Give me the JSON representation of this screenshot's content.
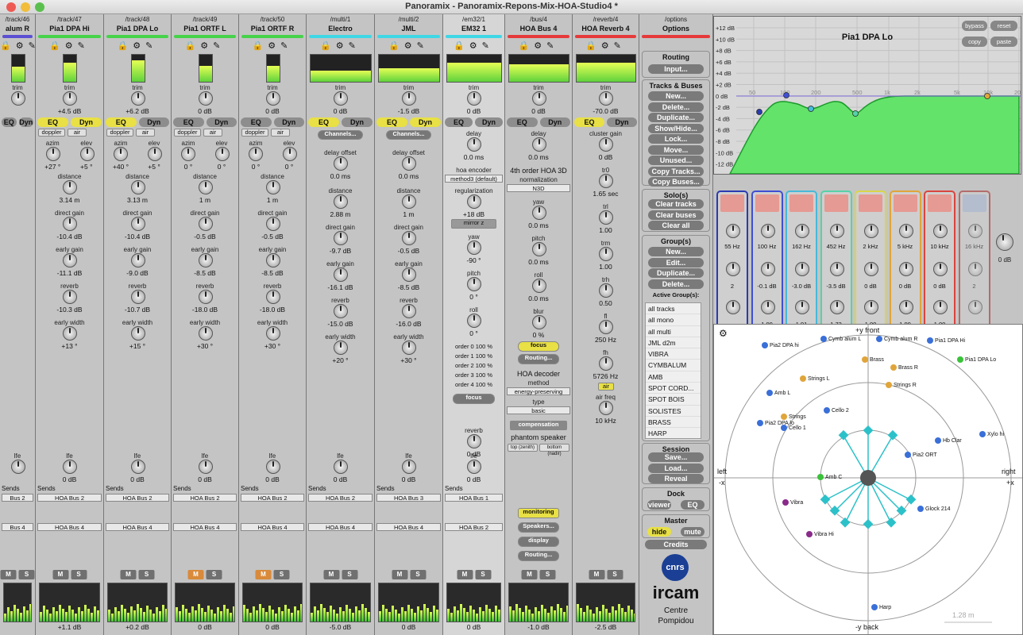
{
  "window": {
    "title": "Panoramix - Panoramix-Repons-Mix-HOA-Studio4 *"
  },
  "strips": [
    {
      "path": "/track/46",
      "name": "alum R",
      "color": "#5b4fd3",
      "trim": "",
      "eq": "EQ",
      "dyn": "Dyn",
      "fader": "",
      "sends1": "Bus 2",
      "sends2": "Bus 4"
    },
    {
      "path": "/track/47",
      "name": "Pia1 DPA Hi",
      "color": "#46d34a",
      "trim": "+4.5 dB",
      "eq": "EQ",
      "dyn": "Dyn",
      "azim": "+27 °",
      "elev": "+5 °",
      "distance": "3.14 m",
      "direct": "-10.4 dB",
      "early": "-11.1 dB",
      "reverb": "-10.3 dB",
      "width": "+13 °",
      "lfe": "0 dB",
      "fader": "+1.1 dB",
      "sends1": "HOA Bus 2",
      "sends2": "HOA Bus 4"
    },
    {
      "path": "/track/48",
      "name": "Pia1 DPA Lo",
      "color": "#46d34a",
      "trim": "+6.2 dB",
      "eq": "EQ",
      "dyn": "Dyn",
      "azim": "+40 °",
      "elev": "+5 °",
      "distance": "3.13 m",
      "direct": "-10.4 dB",
      "early": "-9.0 dB",
      "reverb": "-10.7 dB",
      "width": "+15 °",
      "lfe": "0 dB",
      "fader": "+0.2 dB",
      "sends1": "HOA Bus 2",
      "sends2": "HOA Bus 4"
    },
    {
      "path": "/track/49",
      "name": "Pia1 ORTF L",
      "color": "#46d34a",
      "trim": "0 dB",
      "eq": "EQ",
      "dyn": "Dyn",
      "azim": "0 °",
      "elev": "0 °",
      "distance": "1 m",
      "direct": "-0.5 dB",
      "early": "-8.5 dB",
      "reverb": "-18.0 dB",
      "width": "+30 °",
      "lfe": "0 dB",
      "fader": "0 dB",
      "sends1": "HOA Bus 2",
      "sends2": "HOA Bus 4"
    },
    {
      "path": "/track/50",
      "name": "Pia1 ORTF R",
      "color": "#46d34a",
      "trim": "0 dB",
      "eq": "EQ",
      "dyn": "Dyn",
      "azim": "0 °",
      "elev": "0 °",
      "distance": "1 m",
      "direct": "-0.5 dB",
      "early": "-8.5 dB",
      "reverb": "-18.0 dB",
      "width": "+30 °",
      "lfe": "0 dB",
      "fader": "0 dB",
      "sends1": "HOA Bus 2",
      "sends2": "HOA Bus 4"
    },
    {
      "path": "/multi/1",
      "name": "Electro",
      "color": "#3fd7e6",
      "trim": "0 dB",
      "eq": "EQ",
      "dyn": "Dyn",
      "delay": "0.0 ms",
      "distance": "2.88 m",
      "direct": "-9.7 dB",
      "early": "-16.1 dB",
      "reverb": "-15.0 dB",
      "width": "+20 °",
      "lfe": "0 dB",
      "fader": "-5.0 dB",
      "sends1": "HOA Bus 2",
      "sends2": "HOA Bus 4"
    },
    {
      "path": "/multi/2",
      "name": "JML",
      "color": "#3fd7e6",
      "trim": "-1.5 dB",
      "eq": "EQ",
      "dyn": "Dyn",
      "delay": "0.0 ms",
      "distance": "1 m",
      "direct": "-0.5 dB",
      "early": "-8.5 dB",
      "reverb": "-16.0 dB",
      "width": "+30 °",
      "lfe": "0 dB",
      "fader": "0 dB",
      "sends1": "HOA Bus 3",
      "sends2": "HOA Bus 4"
    },
    {
      "path": "/em32/1",
      "name": "EM32 1",
      "color": "#3fd7e6",
      "trim": "0 dB",
      "eq": "EQ",
      "dyn": "Dyn",
      "delay": "0.0 ms",
      "encoder": "method3 (default)",
      "regularization": "+18 dB",
      "yaw": "-90 °",
      "pitch": "0 °",
      "roll": "0 °",
      "reverb": "0 dB",
      "lfe": "0 dB",
      "fader": "0 dB",
      "sends1": "HOA Bus 1",
      "sends2": "HOA Bus 2"
    },
    {
      "path": "/bus/4",
      "name": "HOA Bus 4",
      "color": "#e63a3a",
      "trim": "0 dB",
      "eq": "EQ",
      "dyn": "Dyn",
      "delay": "0.0 ms",
      "fader": "-1.0 dB"
    },
    {
      "path": "/reverb/4",
      "name": "HOA Reverb 4",
      "color": "#e63a3a",
      "trim": "-70.0 dB",
      "eq": "EQ",
      "dyn": "Dyn",
      "cluster": "0 dB",
      "tr0": "1.65 sec",
      "trl": "1.00",
      "trm": "1.00",
      "trh": "0.50",
      "fl": "250 Hz",
      "fh": "5726 Hz",
      "airfreq": "10 kHz",
      "fader": "-2.5 dB"
    }
  ],
  "labels": {
    "trim": "trim",
    "elev": "elev",
    "azim": "azim",
    "distance": "distance",
    "delay": "delay",
    "delay_offset": "delay offset",
    "direct": "direct gain",
    "early": "early gain",
    "reverb": "reverb",
    "width": "early width",
    "lfe": "lfe",
    "sends": "Sends",
    "doppler": "doppler",
    "air": "air",
    "channels": "Channels...",
    "offset": "offset",
    "mirror": "mirror z",
    "yaw": "yaw",
    "pitch": "pitch",
    "roll": "roll",
    "regularization": "regularization",
    "hoa_encoder": "hoa encoder",
    "focus": "focus",
    "cluster": "cluster gain",
    "tr0": "tr0",
    "trl": "trl",
    "trm": "trm",
    "trh": "trh",
    "fl": "fl",
    "fh": "fh",
    "airfreq": "air freq",
    "blur": "blur",
    "blur_val": "0 %",
    "routing": "Routing...",
    "mute": "M",
    "solo": "S"
  },
  "em32_orders": [
    "order 0  100 %",
    "order 1  100 %",
    "order 2  100 %",
    "order 3  100 %",
    "order 4  100 %"
  ],
  "bus4": {
    "title": "4th order HOA 3D",
    "normalization": "normalization",
    "norm_val": "N3D",
    "decoder": "HOA decoder",
    "method": "method",
    "method_val": "energy-preserving",
    "type": "type",
    "type_val": "basic",
    "compensation": "compensation",
    "phantom": "phantom speaker",
    "top": "top (zenith)",
    "bottom": "bottom (nadir)",
    "monitoring": "monitoring",
    "speakers": "Speakers...",
    "display": "display",
    "routing": "Routing..."
  },
  "options": {
    "path": "/options",
    "name": "Options",
    "routing_h": "Routing",
    "input": "Input...",
    "tracks_h": "Tracks & Buses",
    "tracks_buttons": [
      "New...",
      "Delete...",
      "Duplicate...",
      "Show/Hide...",
      "Lock...",
      "Move...",
      "Unused...",
      "Copy Tracks...",
      "Copy Buses..."
    ],
    "solo_h": "Solo(s)",
    "solo_buttons": [
      "Clear tracks",
      "Clear buses",
      "Clear all"
    ],
    "group_h": "Group(s)",
    "group_buttons": [
      "New...",
      "Edit...",
      "Duplicate...",
      "Delete..."
    ],
    "active_h": "Active Group(s):",
    "active_list": [
      "all tracks",
      "all mono",
      "all multi",
      "JML d2m",
      "VIBRA",
      "CYMBALUM",
      "AMB",
      "SPOT CORD...",
      "SPOT BOIS",
      "SOLISTES",
      "BRASS",
      "HARP"
    ],
    "session_h": "Session",
    "session_buttons": [
      "Save...",
      "Load...",
      "Reveal"
    ],
    "dock_h": "Dock",
    "viewer": "viewer",
    "eq": "EQ",
    "master_h": "Master",
    "hide": "hide",
    "mute": "mute",
    "credits": "Credits",
    "logo1": "cnrs",
    "logo2": "ircam",
    "logo3": "Centre",
    "logo4": "Pompidou"
  },
  "eq": {
    "title": "Pia1 DPA Lo",
    "bypass": "bypass",
    "reset": "reset",
    "copy": "copy",
    "paste": "paste",
    "db_ticks": [
      "+12 dB",
      "+10 dB",
      "+8 dB",
      "+6 dB",
      "+4 dB",
      "+2 dB",
      "0 dB",
      "-2 dB",
      "-4 dB",
      "-6 dB",
      "-8 dB",
      "-10 dB",
      "-12 dB"
    ],
    "freq_ticks": [
      "50",
      "100",
      "200",
      "500",
      "1k",
      "2k",
      "5k",
      "10k",
      "20k"
    ],
    "bands": [
      {
        "freq": "55 Hz",
        "gain": "2",
        "q": "",
        "color": "#2a3bb0"
      },
      {
        "freq": "100 Hz",
        "gain": "-0.1 dB",
        "q": "1.00",
        "color": "#3f4fd3"
      },
      {
        "freq": "162 Hz",
        "gain": "-3.0 dB",
        "q": "1.91",
        "color": "#47b9d9"
      },
      {
        "freq": "452 Hz",
        "gain": "-3.5 dB",
        "q": "1.73",
        "color": "#57d1a8"
      },
      {
        "freq": "2 kHz",
        "gain": "0 dB",
        "q": "1.00",
        "color": "#d9d54a"
      },
      {
        "freq": "5 kHz",
        "gain": "0 dB",
        "q": "1.00",
        "color": "#e0a53a"
      },
      {
        "freq": "10 kHz",
        "gain": "0 dB",
        "q": "1.00",
        "color": "#d9453f"
      },
      {
        "freq": "16 kHz",
        "gain": "2",
        "q": "",
        "color": "#a33"
      }
    ],
    "master_gain": "0 dB"
  },
  "panner": {
    "front": "+y front",
    "back": "-y back",
    "left": "left",
    "left2": "-x",
    "right": "right",
    "right2": "+x",
    "scale": "1.28 m",
    "sources": [
      "Pia2 DPA hi",
      "Cymb alum L",
      "Cymb alum R",
      "Pia1 DPA Hi",
      "Pia1 DPA Lo",
      "Brass",
      "Brass R",
      "Strings L",
      "Strings R",
      "Amb L",
      "Pia2 DPA lo",
      "Cello 1",
      "Cello 2",
      "Strings",
      "Vibra",
      "Vibra Hi",
      "Glock 214",
      "Harp",
      "Xylo hi",
      "Hb Clar",
      "Amb C",
      "Pia2 ORT"
    ]
  }
}
